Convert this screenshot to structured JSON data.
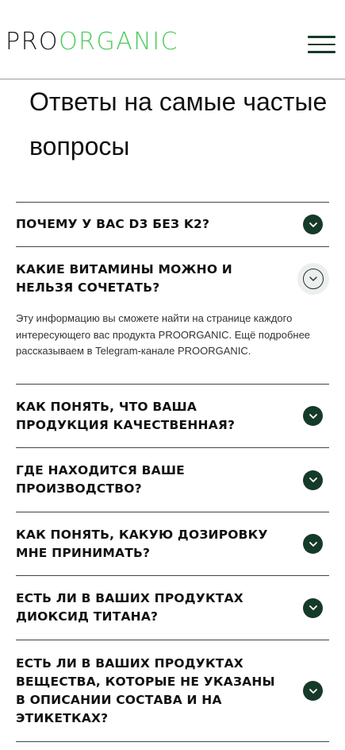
{
  "header": {
    "logo_pro": "PRO",
    "logo_organic": "ORGANIC"
  },
  "page_title": "Ответы на самые частые вопросы",
  "faq": {
    "items": [
      {
        "question": "Почему у вас D3 без K2?",
        "expanded": false
      },
      {
        "question": "Какие витамины можно и нельзя сочетать?",
        "expanded": true,
        "answer": "Эту информацию вы сможете найти на странице каждого интересующего вас продукта PROORGANIC. Ещё подробнее рассказываем в Telegram-канале PROORGANIC."
      },
      {
        "question": "Как понять, что ваша продукция качественная?",
        "expanded": false
      },
      {
        "question": "Где находится ваше производство?",
        "expanded": false
      },
      {
        "question": "Как понять, какую дозировку мне принимать?",
        "expanded": false
      },
      {
        "question": "Есть ли в ваших продуктах диоксид титана?",
        "expanded": false
      },
      {
        "question": "Есть ли в ваших продуктах вещества, которые не указаны в описании состава и на этикетках?",
        "expanded": false
      }
    ]
  },
  "colors": {
    "brand_green": "#4ccb5a",
    "dark_green": "#163a2a"
  },
  "icons": {
    "menu": "hamburger-menu-icon",
    "collapsed": "chevron-down-icon",
    "expanded": "chevron-down-outline-icon"
  }
}
